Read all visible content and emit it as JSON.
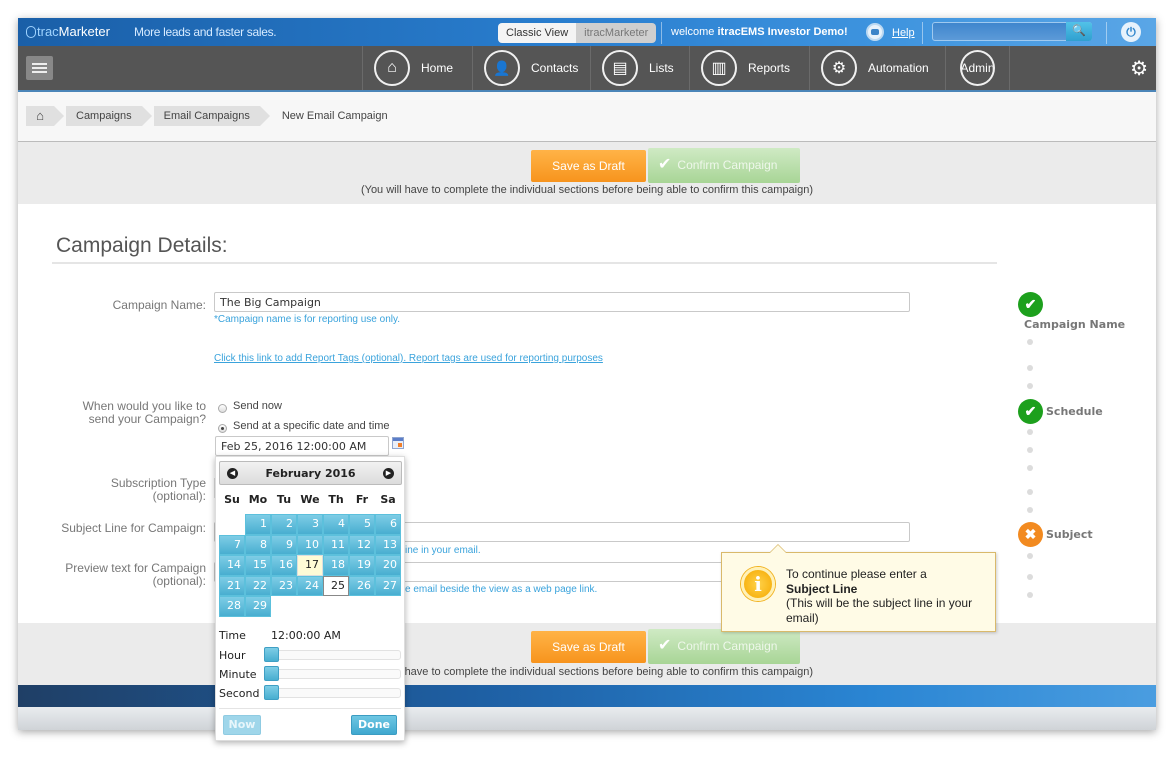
{
  "header": {
    "logo_prefix": "trac",
    "logo_suffix": "Marketer",
    "tagline": "More leads and faster sales.",
    "view_toggle": [
      {
        "label": "Classic View",
        "active": true
      },
      {
        "label": "itracMarketer",
        "active": false
      }
    ],
    "welcome_prefix": "welcome",
    "welcome_user": "itracEMS Investor Demo!",
    "help_label": "Help",
    "search_value": "",
    "icons": {
      "help": "help-user-icon",
      "search": "search-icon",
      "power": "power-icon"
    }
  },
  "nav": {
    "items": [
      {
        "label": "Home",
        "icon": "⌂"
      },
      {
        "label": "Contacts",
        "icon": "👤"
      },
      {
        "label": "Lists",
        "icon": "▤"
      },
      {
        "label": "Reports",
        "icon": "▥"
      },
      {
        "label": "Automation",
        "icon": "⚙"
      },
      {
        "label": "Admin",
        "icon": ""
      }
    ],
    "settings_icon": "⚙"
  },
  "breadcrumb": {
    "home_icon": "⌂",
    "items": [
      "Campaigns",
      "Email Campaigns"
    ],
    "current": "New Email Campaign"
  },
  "actions": {
    "save_draft": "Save as Draft",
    "confirm": "Confirm Campaign",
    "confirm_check": "✔",
    "note": "(You will have to complete the individual sections before being able to confirm this campaign)"
  },
  "section": {
    "title": "Campaign Details:"
  },
  "form": {
    "campaign_name": {
      "label": "Campaign Name:",
      "value": "The Big Campaign",
      "hint": "*Campaign name is for reporting use only."
    },
    "report_tags_link": "Click this link to add Report Tags (optional). Report tags are used for reporting purposes",
    "schedule": {
      "label_line1": "When would you like to",
      "label_line2": "send your Campaign?",
      "options": [
        {
          "label": "Send now",
          "checked": false
        },
        {
          "label": "Send at a specific date and time",
          "checked": true
        }
      ],
      "datetime_value": "Feb 25, 2016 12:00:00 AM"
    },
    "subscription_type": {
      "label_line1": "Subscription Type",
      "label_line2": "(optional):"
    },
    "subject_line": {
      "label": "Subject Line for Campaign:",
      "value": "",
      "hint_visible": "ine in your email."
    },
    "preview_text": {
      "label_line1": "Preview text for Campaign",
      "label_line2": "(optional):",
      "value": "",
      "hint_visible": "e email beside the view as a web page link."
    }
  },
  "progress": {
    "steps": [
      {
        "label": "Campaign Name",
        "status": "complete",
        "glyph": "✔"
      },
      {
        "label": "Schedule",
        "status": "complete",
        "glyph": "✔"
      },
      {
        "label": "Subject",
        "status": "error",
        "glyph": "✖"
      }
    ]
  },
  "tooltip": {
    "icon": "i",
    "line1": "To continue please enter a",
    "bold": "Subject Line",
    "line3": "(This will be the subject line in your email)"
  },
  "datepicker": {
    "month_title": "February 2016",
    "prev_icon": "◀",
    "next_icon": "▶",
    "weekdays": [
      "Su",
      "Mo",
      "Tu",
      "We",
      "Th",
      "Fr",
      "Sa"
    ],
    "first_weekday_offset": 1,
    "days_in_month": 29,
    "today": 17,
    "selected": 25,
    "time_label": "Time",
    "time_value": "12:00:00 AM",
    "sliders": [
      {
        "label": "Hour",
        "value": 0,
        "max": 23
      },
      {
        "label": "Minute",
        "value": 0,
        "max": 59
      },
      {
        "label": "Second",
        "value": 0,
        "max": 59
      }
    ],
    "now_label": "Now",
    "done_label": "Done"
  }
}
